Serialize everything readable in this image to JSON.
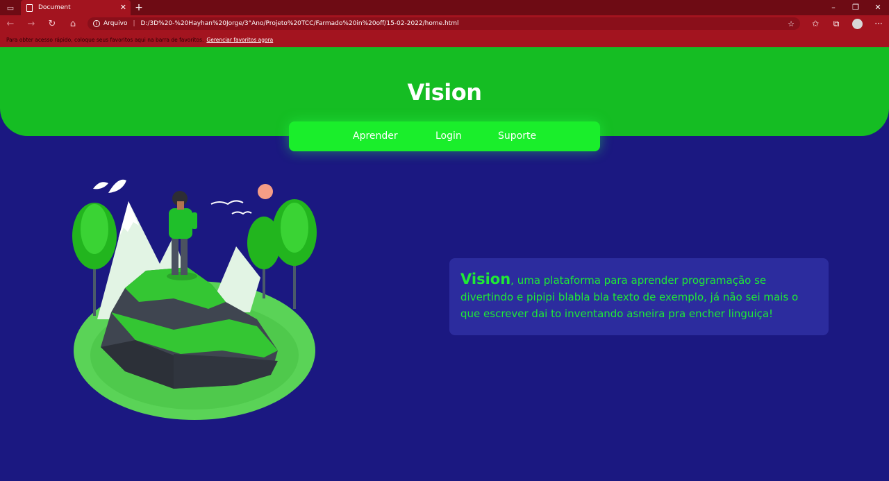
{
  "browser": {
    "tab_title": "Document",
    "address_label": "Arquivo",
    "url": "D:/3D%20-%20Hayhan%20Jorge/3°Ano/Projeto%20TCC/Farmado%20in%20off/15-02-2022/home.html",
    "favorites_message": "Para obter acesso rápido, coloque seus favoritos aqui na barra de favoritos.",
    "favorites_link": "Gerenciar favoritos agora"
  },
  "header": {
    "brand": "Vision"
  },
  "nav": {
    "items": [
      {
        "label": "Aprender"
      },
      {
        "label": "Login"
      },
      {
        "label": "Suporte"
      }
    ]
  },
  "intro": {
    "highlight": "Vision",
    "text": ", uma plataforma para aprender programação se divertindo e pipipi blabla bla texto de exemplo, já não sei mais o que escrever dai to inventando asneira pra encher linguiça!"
  },
  "colors": {
    "page_background": "#1b1881",
    "header_green": "#15bd23",
    "nav_green": "#1aee2b",
    "card_background": "#2c2c9e",
    "card_text": "#1fea35",
    "browser_chrome": "#a3141f"
  }
}
